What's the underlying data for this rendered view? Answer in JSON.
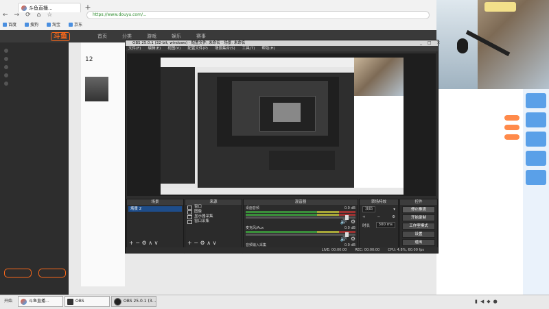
{
  "browser": {
    "tab_title": "斗鱼直播...",
    "new_tab": "+",
    "nav": {
      "back": "←",
      "forward": "→",
      "reload": "⟳",
      "home": "⌂",
      "star": "☆"
    },
    "url": "https://www.douyu.com/...",
    "bookmarks": [
      "百度",
      "搜狗",
      "淘宝",
      "京东"
    ]
  },
  "site": {
    "logo": "斗鱼",
    "nav": [
      "首页",
      "分类",
      "游戏",
      "娱乐",
      "赛事"
    ],
    "follow_count": "12",
    "follow_label": "",
    "sidebar_buttons": [
      "",
      ""
    ]
  },
  "obs": {
    "title": "OBS 25.0.1 (32-bit, windows) - 配置文件: 未命名 - 场景: 未命名",
    "winbtns": "_ □ ×",
    "menu": [
      "文件(F)",
      "编辑(E)",
      "视图(V)",
      "配置文件(P)",
      "场景集合(S)",
      "工具(T)",
      "帮助(H)"
    ],
    "docks": {
      "scenes": "场景",
      "sources": "来源",
      "mixer": "混音器",
      "transitions": "转场特效",
      "controls": "控件"
    },
    "scene_items": [
      "场景 2"
    ],
    "source_items": [
      "窗口",
      "图像",
      "显示器采集",
      "窗口采集"
    ],
    "mixer_rows": [
      {
        "name": "桌面音频",
        "db": "0.0 dB"
      },
      {
        "name": "麦克风/Aux",
        "db": "0.0 dB"
      },
      {
        "name": "音频输入采集",
        "db": "0.0 dB"
      }
    ],
    "transition": {
      "type": "淡出",
      "duration_label": "时长",
      "duration": "300 ms"
    },
    "controls": [
      "停止推流",
      "开始录制",
      "工作室模式",
      "设置",
      "退出"
    ],
    "status": {
      "live": "LIVE: 00:00:00",
      "rec": "REC: 00:00:00",
      "cpu": "CPU: 4.8%, 60.00 fps"
    },
    "dock_foot": "+ − ⚙ ∧ ∨"
  },
  "taskbar": {
    "start": "开始",
    "tasks": [
      "斗鱼直播...",
      "OBS",
      "OBS 25.0.1 (3..."
    ],
    "clock_time": "",
    "clock_date": ""
  },
  "colors": {
    "accent": "#ff6a1a",
    "obs_bg": "#2e2e2e",
    "scene_selected": "#1e4d8a"
  }
}
